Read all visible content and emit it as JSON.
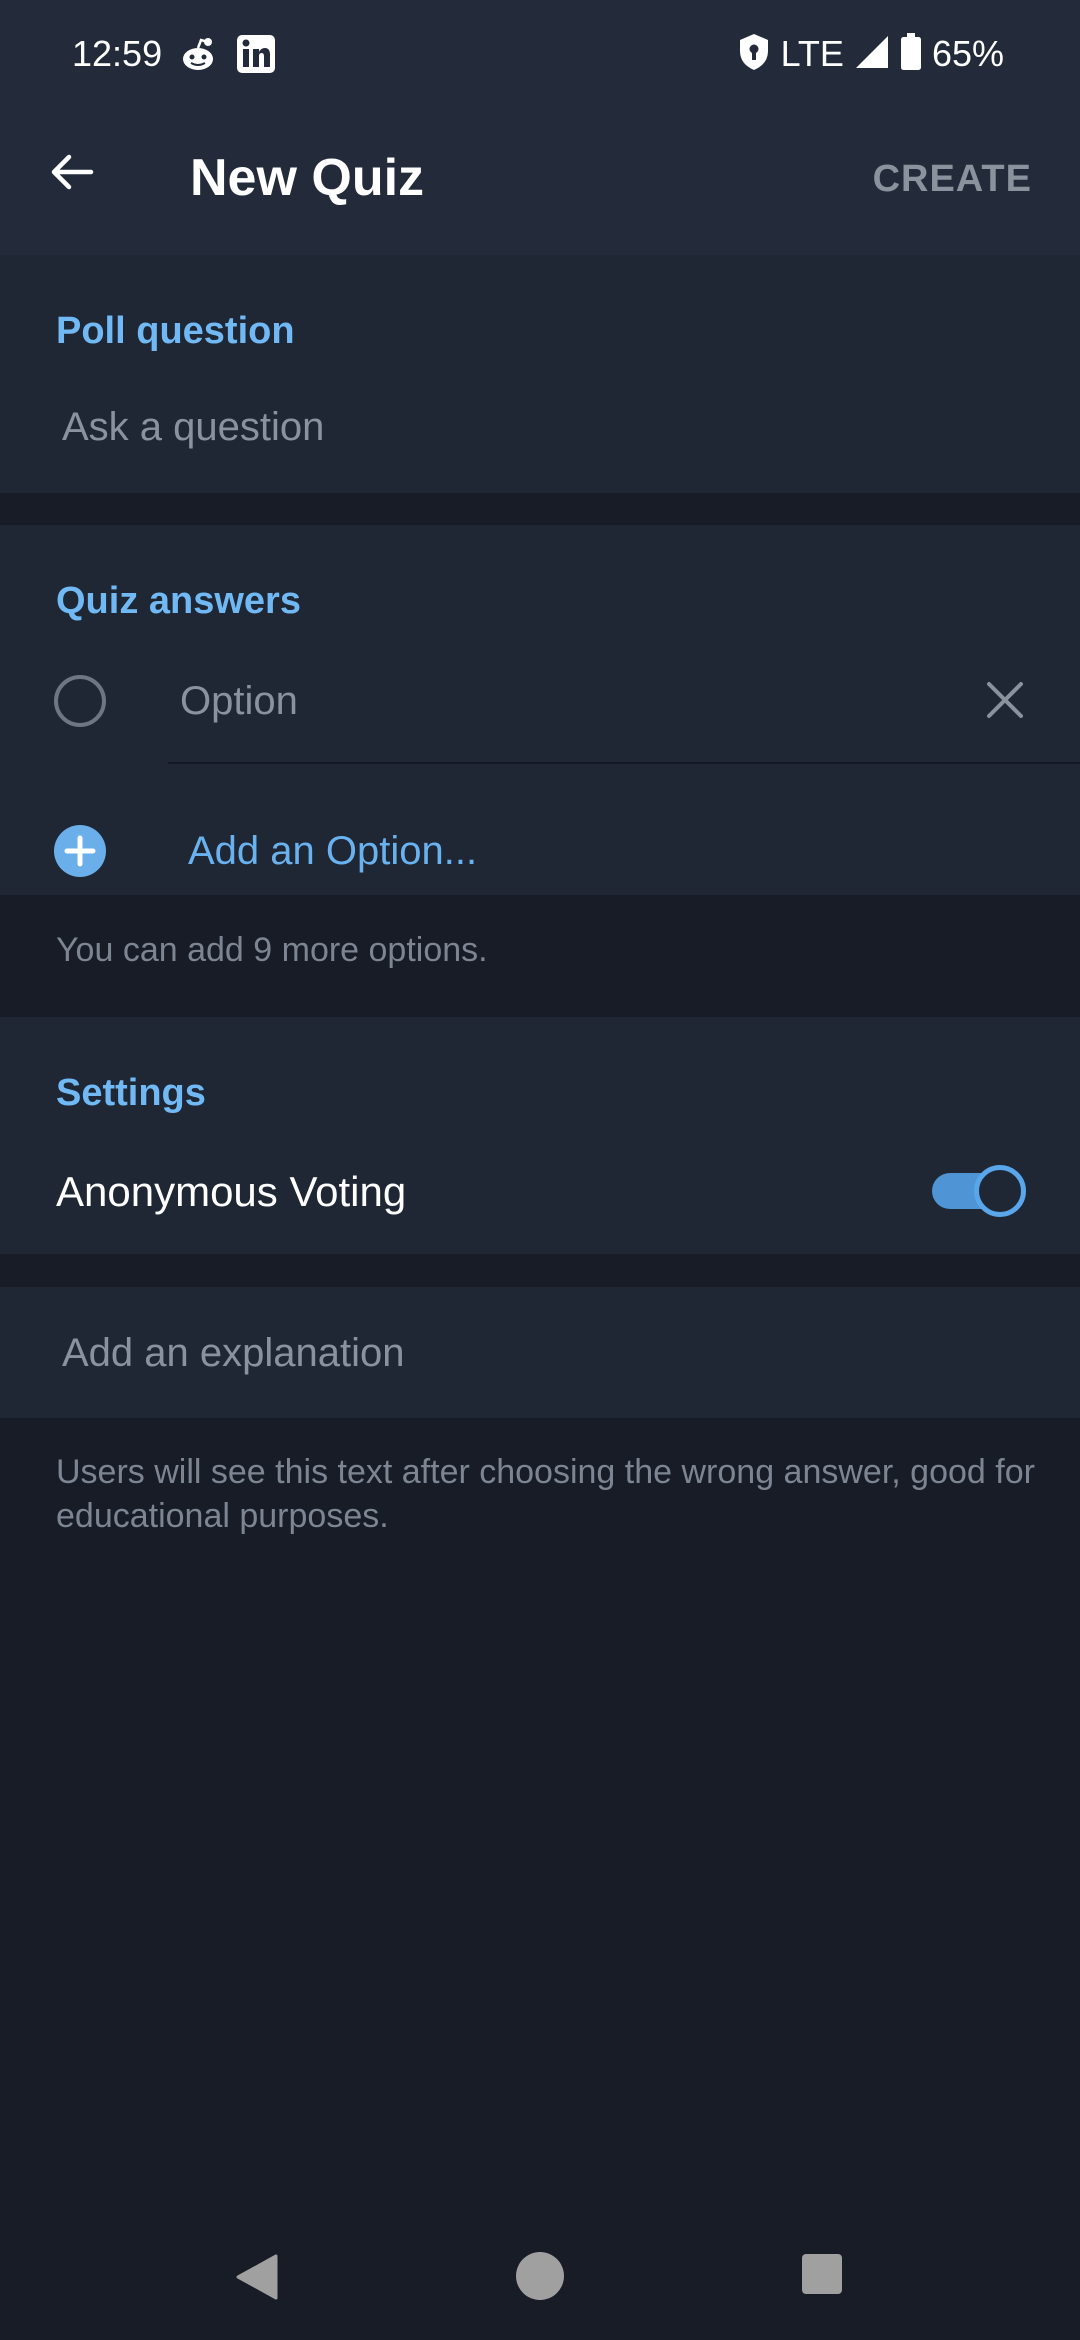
{
  "status_bar": {
    "time": "12:59",
    "network": "LTE",
    "battery": "65%",
    "icons": [
      "reddit-icon",
      "linkedin-icon",
      "vpn-shield-icon",
      "signal-icon",
      "battery-icon"
    ]
  },
  "app_bar": {
    "title": "New Quiz",
    "action": "CREATE",
    "back_icon": "arrow-left-icon"
  },
  "question_section": {
    "header": "Poll question",
    "placeholder": "Ask a question"
  },
  "answers_section": {
    "header": "Quiz answers",
    "options": [
      {
        "placeholder": "Option",
        "correct": false
      }
    ],
    "add_label": "Add an Option...",
    "hint": "You can add 9 more options."
  },
  "settings_section": {
    "header": "Settings",
    "anonymous_label": "Anonymous Voting",
    "anonymous_enabled": true
  },
  "explanation_section": {
    "placeholder": "Add an explanation",
    "hint": "Users will see this text after choosing the wrong answer, good for educational purposes."
  },
  "colors": {
    "accent": "#70b9f5",
    "background": "#171c26",
    "surface": "#1f2734",
    "toolbar": "#232b3a"
  }
}
